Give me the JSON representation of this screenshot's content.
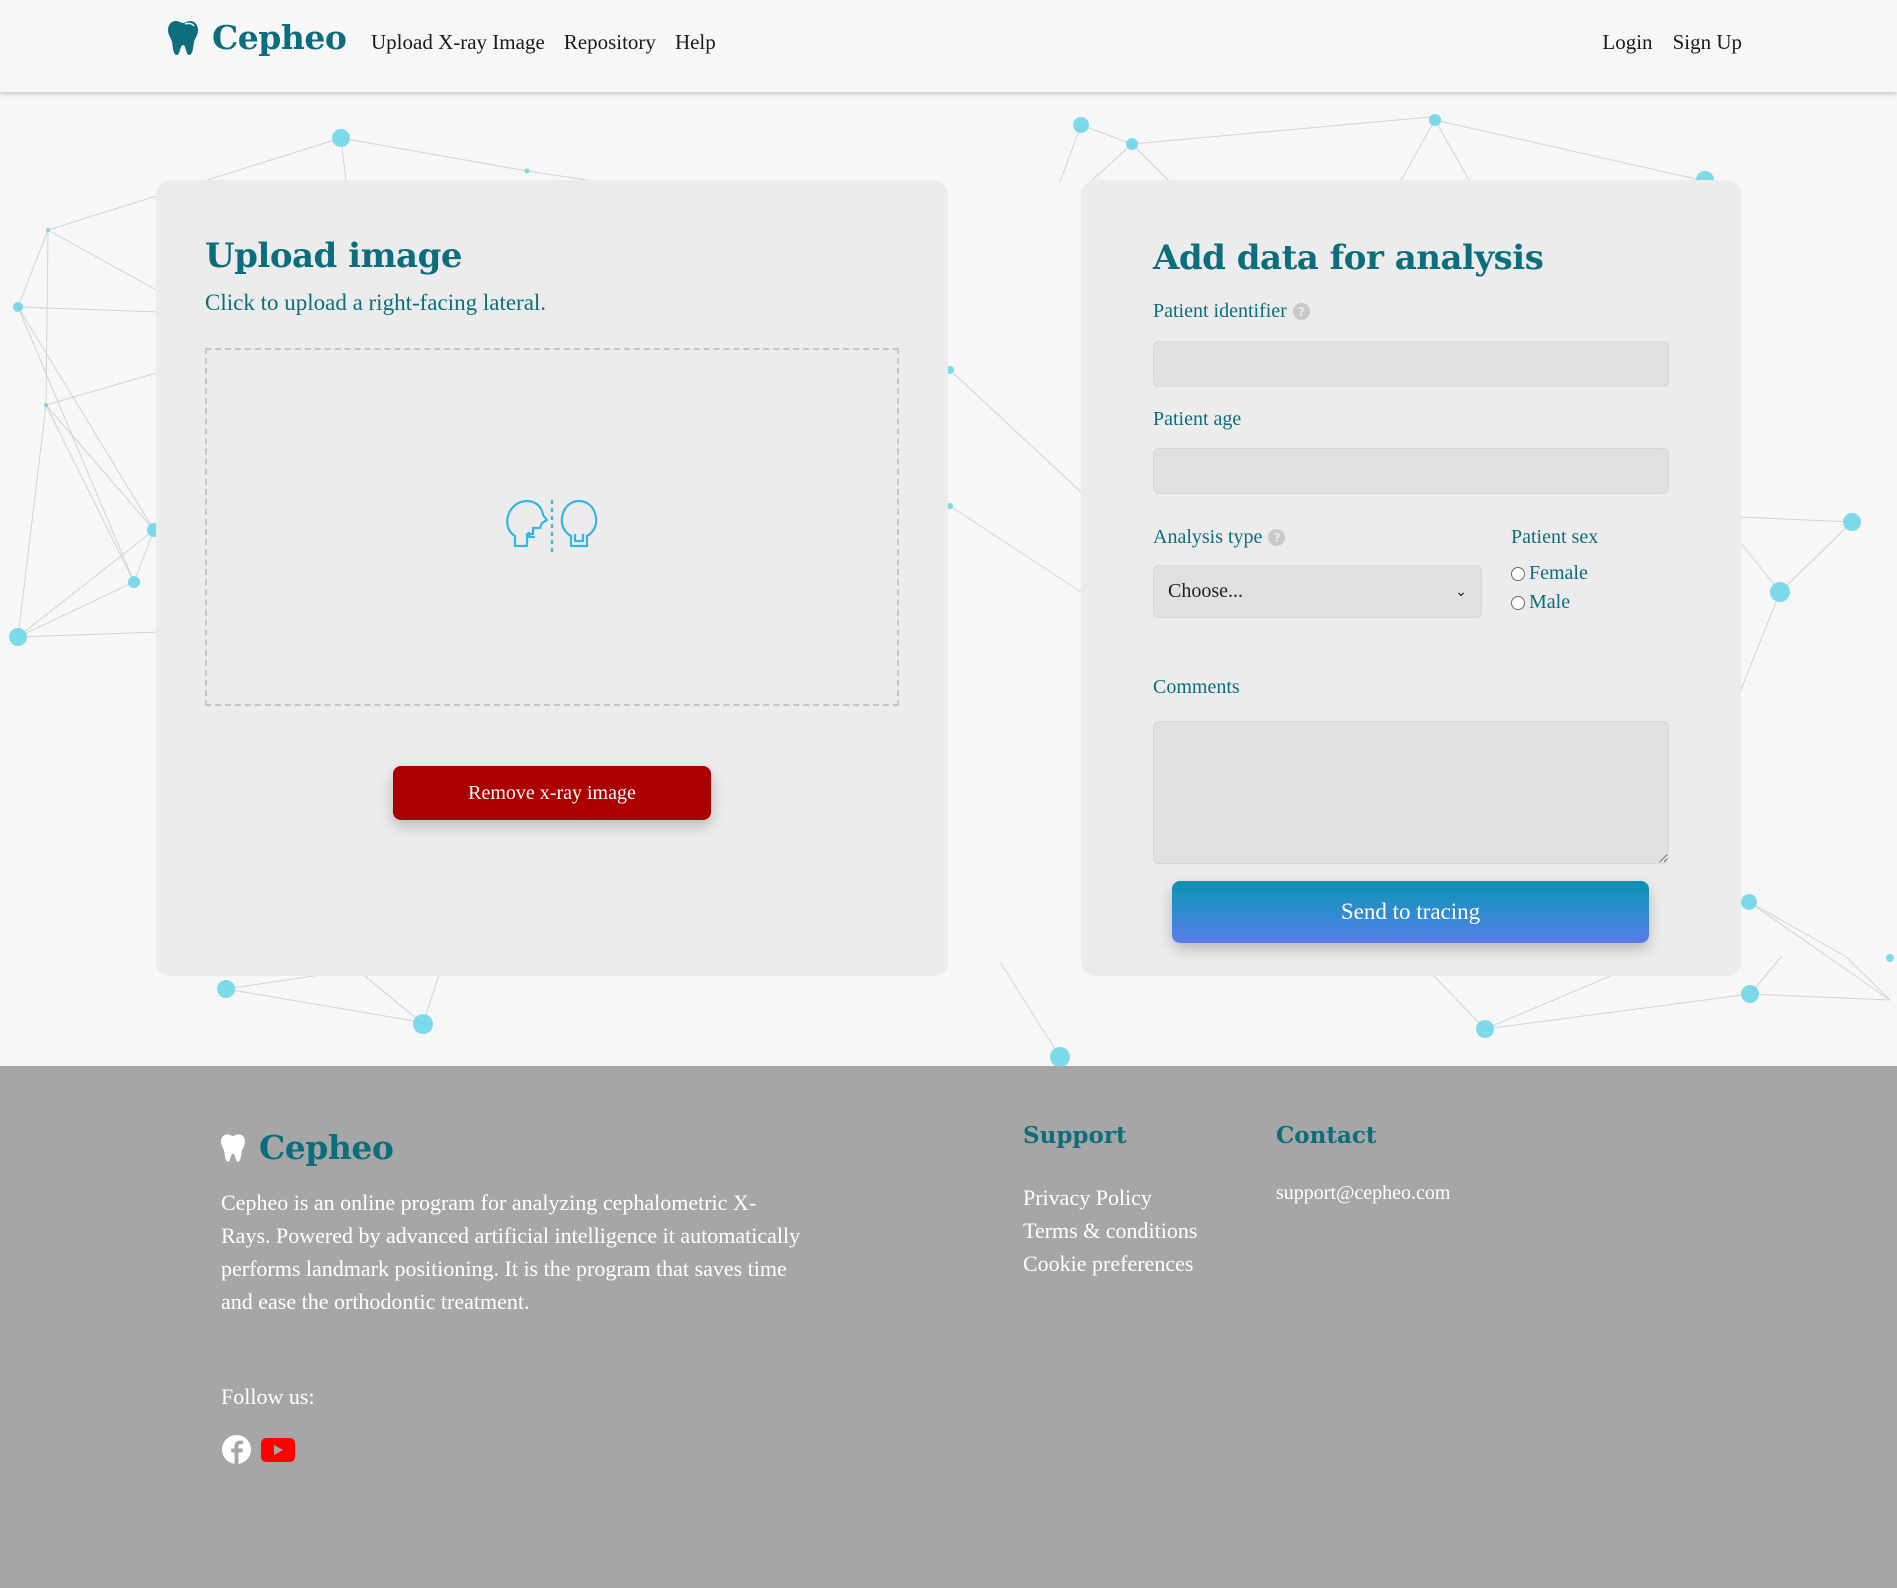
{
  "brand": {
    "name": "Cepheo",
    "logo_icon": "tooth-icon",
    "accent_color": "#0c6e7c"
  },
  "header": {
    "nav": [
      {
        "label": "Upload X-ray Image"
      },
      {
        "label": "Repository"
      },
      {
        "label": "Help"
      }
    ],
    "auth": {
      "login_label": "Login",
      "signup_label": "Sign Up"
    }
  },
  "upload_card": {
    "title": "Upload image",
    "subtitle": "Click to upload a right-facing lateral.",
    "dropzone_icon": "cephalometric-heads-icon",
    "remove_button_label": "Remove x-ray image",
    "remove_button_color": "#ab0000"
  },
  "analysis_card": {
    "title": "Add data for analysis",
    "patient_identifier": {
      "label": "Patient identifier",
      "value": "",
      "help_icon": "question-circle-icon"
    },
    "patient_age": {
      "label": "Patient age",
      "value": ""
    },
    "analysis_type": {
      "label": "Analysis type",
      "selected": "Choose...",
      "help_icon": "question-circle-icon"
    },
    "patient_sex": {
      "label": "Patient sex",
      "options": [
        {
          "label": "Female",
          "checked": false
        },
        {
          "label": "Male",
          "checked": false
        }
      ]
    },
    "comments": {
      "label": "Comments",
      "value": ""
    },
    "send_button_label": "Send to tracing"
  },
  "footer": {
    "brand_name": "Cepheo",
    "description": "Cepheo is an online program for analyzing cephalometric X-Rays. Powered by advanced artificial intelligence it automatically performs landmark positioning. It is the program that saves time and ease the orthodontic treatment.",
    "follow_label": "Follow us:",
    "social": [
      {
        "name": "facebook-icon"
      },
      {
        "name": "youtube-icon",
        "color": "#ff0000"
      }
    ],
    "support": {
      "title": "Support",
      "links": [
        {
          "label": "Privacy Policy"
        },
        {
          "label": "Terms & conditions"
        },
        {
          "label": "Cookie preferences"
        }
      ]
    },
    "contact": {
      "title": "Contact",
      "email": "support@cepheo.com"
    }
  }
}
